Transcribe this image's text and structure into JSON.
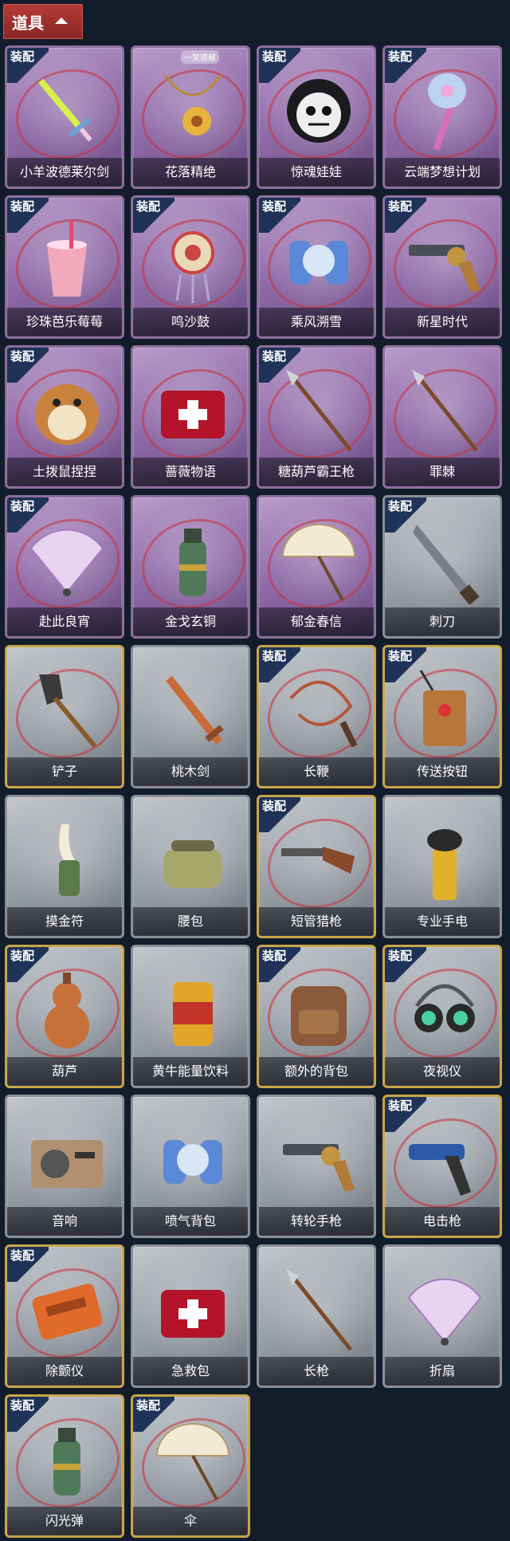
{
  "header": {
    "title": "道具"
  },
  "tag_label": "装配",
  "watermark": "一笑德耀",
  "items": [
    {
      "label": "小羊波德莱尔剑",
      "icon": "sword-icon",
      "tagged": true,
      "style": "purple"
    },
    {
      "label": "花落精绝",
      "icon": "flower-necklace-icon",
      "tagged": false,
      "style": "purple"
    },
    {
      "label": "惊魂娃娃",
      "icon": "doll-head-icon",
      "tagged": true,
      "style": "purple"
    },
    {
      "label": "云端梦想计划",
      "icon": "bubble-wand-icon",
      "tagged": true,
      "style": "purple"
    },
    {
      "label": "珍珠芭乐莓莓",
      "icon": "drink-cup-icon",
      "tagged": true,
      "style": "purple"
    },
    {
      "label": "鸣沙鼓",
      "icon": "drum-charm-icon",
      "tagged": true,
      "style": "purple"
    },
    {
      "label": "乘风溯雪",
      "icon": "jetpack-icon",
      "tagged": true,
      "style": "purple"
    },
    {
      "label": "新星时代",
      "icon": "revolver-icon",
      "tagged": true,
      "style": "purple"
    },
    {
      "label": "土拨鼠捏捏",
      "icon": "hamster-icon",
      "tagged": true,
      "style": "purple"
    },
    {
      "label": "蔷薇物语",
      "icon": "first-aid-kit-icon",
      "tagged": false,
      "style": "purple"
    },
    {
      "label": "糖葫芦霸王枪",
      "icon": "spear-icon",
      "tagged": true,
      "style": "purple"
    },
    {
      "label": "罪棘",
      "icon": "spear-icon",
      "tagged": false,
      "style": "purple"
    },
    {
      "label": "赴此良宵",
      "icon": "fan-icon",
      "tagged": true,
      "style": "purple"
    },
    {
      "label": "金戈玄铜",
      "icon": "grenade-icon",
      "tagged": false,
      "style": "purple"
    },
    {
      "label": "郁金春信",
      "icon": "umbrella-icon",
      "tagged": false,
      "style": "purple"
    },
    {
      "label": "刺刀",
      "icon": "knife-icon",
      "tagged": true,
      "style": "grey"
    },
    {
      "label": "铲子",
      "icon": "shovel-icon",
      "tagged": false,
      "style": "gold"
    },
    {
      "label": "桃木剑",
      "icon": "wood-sword-icon",
      "tagged": false,
      "style": "grey"
    },
    {
      "label": "长鞭",
      "icon": "whip-icon",
      "tagged": true,
      "style": "gold"
    },
    {
      "label": "传送按钮",
      "icon": "remote-icon",
      "tagged": true,
      "style": "gold"
    },
    {
      "label": "摸金符",
      "icon": "tooth-charm-icon",
      "tagged": false,
      "style": "grey"
    },
    {
      "label": "腰包",
      "icon": "waist-bag-icon",
      "tagged": false,
      "style": "grey"
    },
    {
      "label": "短管猎枪",
      "icon": "shotgun-icon",
      "tagged": true,
      "style": "gold"
    },
    {
      "label": "专业手电",
      "icon": "flashlight-icon",
      "tagged": false,
      "style": "grey"
    },
    {
      "label": "葫芦",
      "icon": "gourd-icon",
      "tagged": true,
      "style": "gold"
    },
    {
      "label": "黄牛能量饮料",
      "icon": "can-icon",
      "tagged": false,
      "style": "grey"
    },
    {
      "label": "额外的背包",
      "icon": "backpack-icon",
      "tagged": true,
      "style": "gold"
    },
    {
      "label": "夜视仪",
      "icon": "goggles-icon",
      "tagged": true,
      "style": "gold"
    },
    {
      "label": "音响",
      "icon": "radio-icon",
      "tagged": false,
      "style": "grey"
    },
    {
      "label": "喷气背包",
      "icon": "jetpack-icon",
      "tagged": false,
      "style": "grey"
    },
    {
      "label": "转轮手枪",
      "icon": "revolver-icon",
      "tagged": false,
      "style": "grey"
    },
    {
      "label": "电击枪",
      "icon": "taser-icon",
      "tagged": true,
      "style": "gold"
    },
    {
      "label": "除颤仪",
      "icon": "defibrillator-icon",
      "tagged": true,
      "style": "gold"
    },
    {
      "label": "急救包",
      "icon": "first-aid-kit-icon",
      "tagged": false,
      "style": "grey"
    },
    {
      "label": "长枪",
      "icon": "spear-icon",
      "tagged": false,
      "style": "grey"
    },
    {
      "label": "折扇",
      "icon": "fan-icon",
      "tagged": false,
      "style": "grey"
    },
    {
      "label": "闪光弹",
      "icon": "grenade-icon",
      "tagged": true,
      "style": "gold"
    },
    {
      "label": "伞",
      "icon": "umbrella-icon",
      "tagged": true,
      "style": "gold"
    }
  ]
}
